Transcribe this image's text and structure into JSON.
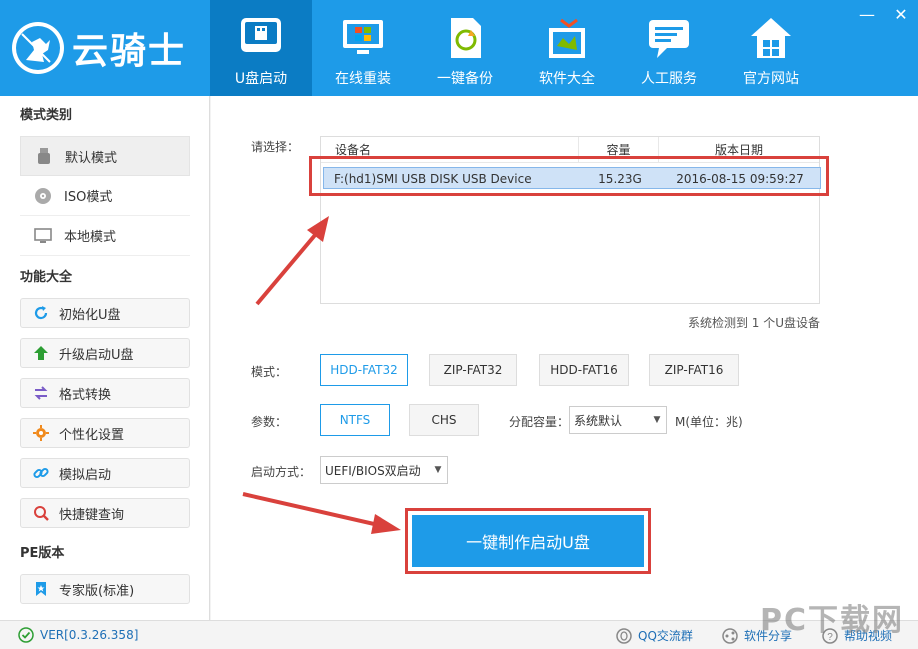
{
  "app": {
    "name": "云骑士"
  },
  "nav": [
    {
      "label": "U盘启动",
      "icon": "usb-icon"
    },
    {
      "label": "在线重装",
      "icon": "monitor-windows-icon"
    },
    {
      "label": "一键备份",
      "icon": "backup-icon"
    },
    {
      "label": "软件大全",
      "icon": "software-box-icon"
    },
    {
      "label": "人工服务",
      "icon": "chat-icon"
    },
    {
      "label": "官方网站",
      "icon": "home-icon"
    }
  ],
  "window": {
    "minimize": "—",
    "close": "✕"
  },
  "sidebar": {
    "mode_title": "模式类别",
    "modes": [
      {
        "label": "默认模式",
        "icon": "usb-drive-icon"
      },
      {
        "label": "ISO模式",
        "icon": "disc-icon"
      },
      {
        "label": "本地模式",
        "icon": "monitor-icon"
      }
    ],
    "func_title": "功能大全",
    "funcs": [
      {
        "label": "初始化U盘",
        "icon": "refresh-icon"
      },
      {
        "label": "升级启动U盘",
        "icon": "arrow-up-icon"
      },
      {
        "label": "格式转换",
        "icon": "swap-icon"
      },
      {
        "label": "个性化设置",
        "icon": "gear-icon"
      },
      {
        "label": "模拟启动",
        "icon": "link-icon"
      },
      {
        "label": "快捷键查询",
        "icon": "search-icon"
      }
    ],
    "pe_title": "PE版本",
    "pe": [
      {
        "label": "专家版(标准)",
        "icon": "bookmark-icon"
      }
    ]
  },
  "main": {
    "select_label": "请选择：",
    "columns": {
      "name": "设备名",
      "capacity": "容量",
      "date": "版本日期"
    },
    "devices": [
      {
        "name": "F:(hd1)SMI USB DISK USB Device",
        "capacity": "15.23G",
        "date": "2016-08-15 09:59:27"
      }
    ],
    "detected": "系统检测到 1 个U盘设备",
    "mode_label": "模式：",
    "modes": [
      "HDD-FAT32",
      "ZIP-FAT32",
      "HDD-FAT16",
      "ZIP-FAT16"
    ],
    "param_label": "参数：",
    "params": [
      "NTFS",
      "CHS"
    ],
    "alloc_label": "分配容量：",
    "alloc_value": "系统默认",
    "alloc_unit": "M(单位：兆)",
    "boot_label": "启动方式：",
    "boot_value": "UEFI/BIOS双启动",
    "make_button": "一键制作启动U盘"
  },
  "footer": {
    "version": "VER[0.3.26.358]",
    "qq": "QQ交流群",
    "share": "软件分享",
    "help": "帮助视频"
  },
  "watermark": "PC下载网",
  "colors": {
    "brand": "#1e9be8",
    "nav_active": "#0b7cc4",
    "highlight": "#d9413c"
  }
}
